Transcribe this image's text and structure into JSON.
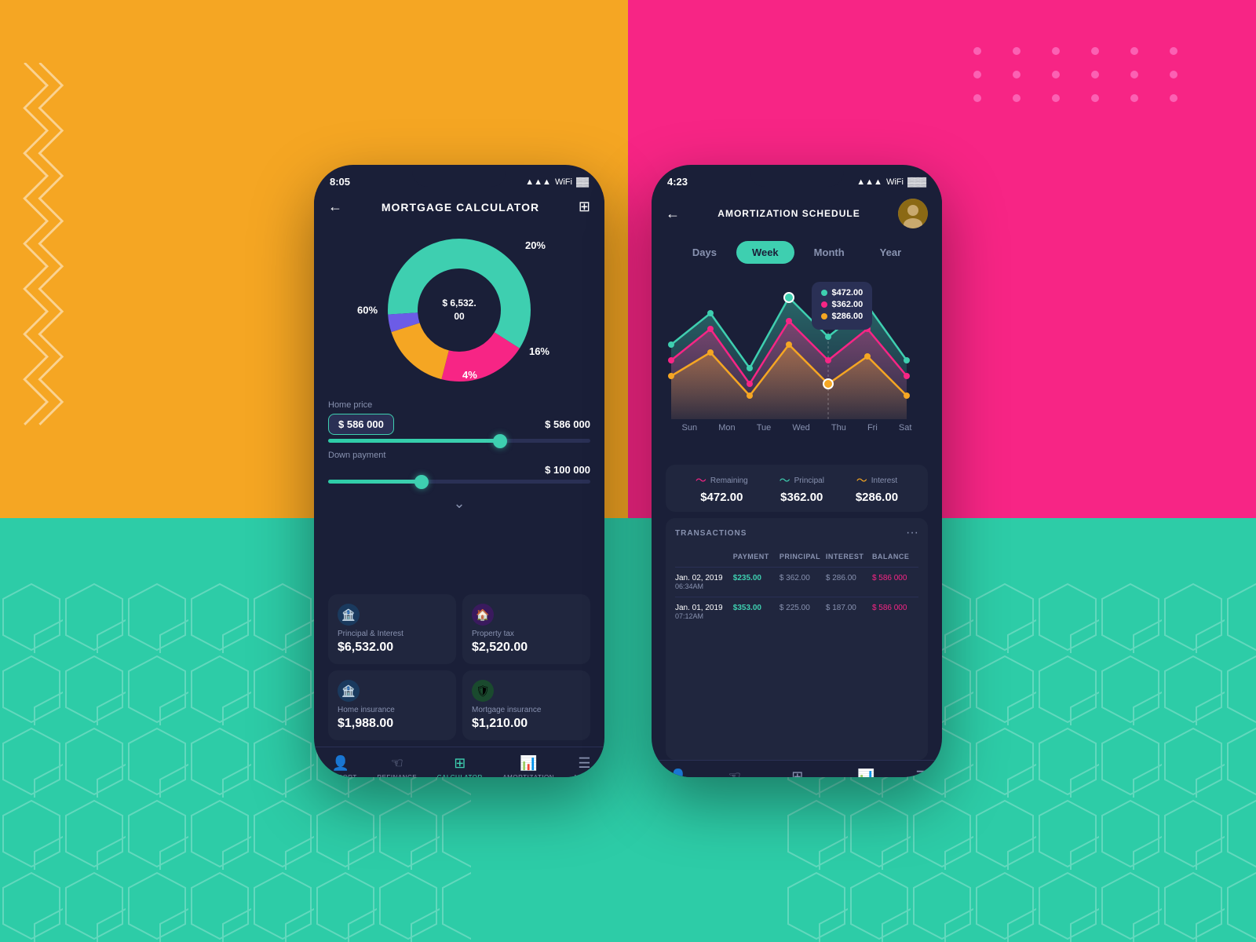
{
  "backgrounds": {
    "left_top": "#f5a623",
    "right_top": "#f72585",
    "bottom": "#2dcca7"
  },
  "phone_left": {
    "status_time": "8:05",
    "header_title": "MORTGAGE CALCULATOR",
    "donut": {
      "center_value": "$ 6,532. 00",
      "segments": [
        {
          "label": "60%",
          "color": "#3ecfb0",
          "percent": 60
        },
        {
          "label": "20%",
          "color": "#f72585",
          "percent": 20
        },
        {
          "label": "16%",
          "color": "#f5a623",
          "percent": 16
        },
        {
          "label": "4%",
          "color": "#6c5ce7",
          "percent": 4
        }
      ]
    },
    "home_price": {
      "label": "Home price",
      "badge_value": "$ 586 000",
      "display_value": "$ 586 000",
      "slider_percent": 65
    },
    "down_payment": {
      "label": "Down payment",
      "display_value": "$ 100 000",
      "slider_percent": 35
    },
    "cards": [
      {
        "label": "Principal & Interest",
        "value": "$6,532.00",
        "icon": "🏦",
        "icon_bg": "#2a3a5e"
      },
      {
        "label": "Property tax",
        "value": "$2,520.00",
        "icon": "🏠",
        "icon_bg": "#3a2a5e"
      },
      {
        "label": "Home insurance",
        "value": "$1,988.00",
        "icon": "🏦",
        "icon_bg": "#2a3a5e"
      },
      {
        "label": "Mortgage insurance",
        "value": "$1,210.00",
        "icon": "🛡",
        "icon_bg": "#3a5e2a"
      }
    ],
    "nav_items": [
      {
        "label": "SUPPORT",
        "active": false
      },
      {
        "label": "REFINaNce",
        "active": false
      },
      {
        "label": "CALCULATOR",
        "active": true
      },
      {
        "label": "AMORTIZATION",
        "active": false
      },
      {
        "label": "MENU",
        "active": false
      }
    ]
  },
  "phone_right": {
    "status_time": "4:23",
    "header_title": "AMORTIZATION SCHEDULE",
    "period_tabs": [
      {
        "label": "Days",
        "active": false
      },
      {
        "label": "Week",
        "active": true
      },
      {
        "label": "Month",
        "active": false
      },
      {
        "label": "Year",
        "active": false
      }
    ],
    "chart": {
      "days": [
        "Sun",
        "Mon",
        "Tue",
        "Wed",
        "Thu",
        "Fri",
        "Sat"
      ],
      "tooltip": {
        "values": [
          "$472.00",
          "$362.00",
          "$286.00"
        ],
        "colors": [
          "#3ecfb0",
          "#f72585",
          "#f5a623"
        ]
      }
    },
    "legend": [
      {
        "label": "Remaining",
        "value": "$472.00",
        "color": "#f72585"
      },
      {
        "label": "Principal",
        "value": "$362.00",
        "color": "#3ecfb0"
      },
      {
        "label": "Interest",
        "value": "$286.00",
        "color": "#f5a623"
      }
    ],
    "transactions": {
      "title": "TRANSACTIONS",
      "rows": [
        {
          "date": "Jan. 02, 2019",
          "time": "06:34AM",
          "payment": "$235.00",
          "principal": "$ 362.00",
          "interest": "$ 286.00",
          "balance": "$ 586 000"
        },
        {
          "date": "Jan. 01, 2019",
          "time": "07:12AM",
          "payment": "$353.00",
          "principal": "$ 225.00",
          "interest": "$ 187.00",
          "balance": "$ 586 000"
        }
      ]
    },
    "nav_items": [
      {
        "label": "SUPPORT",
        "active": false
      },
      {
        "label": "REFINANCE",
        "active": false
      },
      {
        "label": "CALCULATOR",
        "active": false
      },
      {
        "label": "AMORTIZATION",
        "active": true
      },
      {
        "label": "MENU",
        "active": false
      }
    ]
  }
}
